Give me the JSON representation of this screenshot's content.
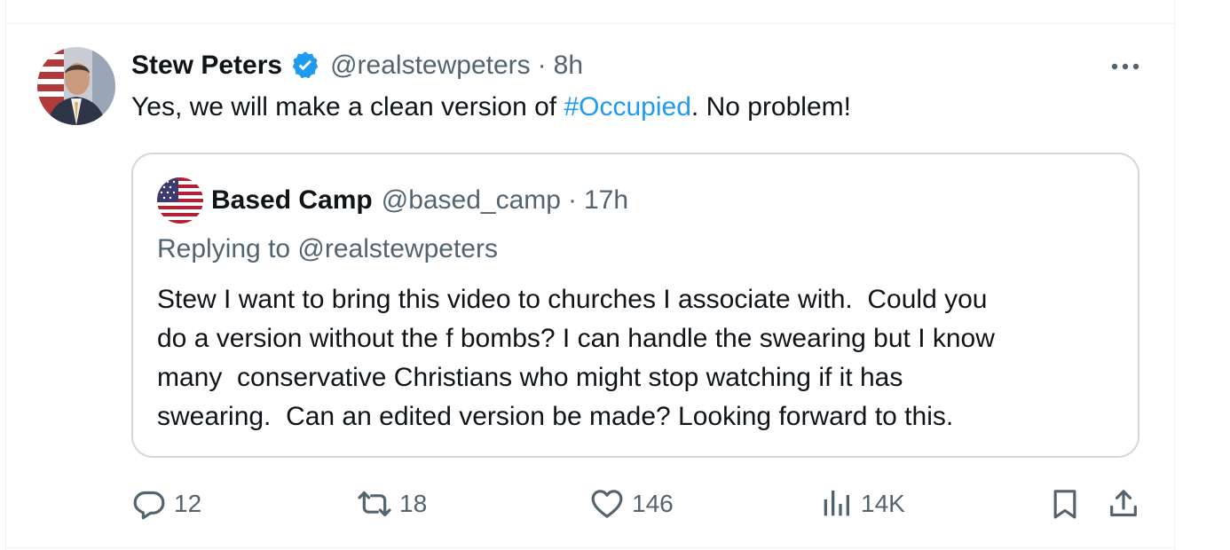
{
  "tweet": {
    "author_name": "Stew Peters",
    "author_handle": "@realstewpeters",
    "separator": "·",
    "time": "8h",
    "text_before": "Yes, we will make a clean version of ",
    "hashtag": "#Occupied",
    "text_after": ". No problem!",
    "more_icon": "more-horizontal-icon"
  },
  "quoted_tweet": {
    "author_name": "Based Camp",
    "author_handle": "@based_camp",
    "separator": "·",
    "time": "17h",
    "replying_to": "Replying to @realstewpeters",
    "text": "Stew I want to bring this video to churches I associate with.  Could you\ndo a version without the f bombs? I can handle the swearing but I know\nmany  conservative Christians who might stop watching if it has\nswearing.  Can an edited version be made? Looking forward to this."
  },
  "actions": {
    "replies": "12",
    "retweets": "18",
    "likes": "146",
    "views": "14K"
  },
  "colors": {
    "accent": "#1d9bf0",
    "text": "#0f1419",
    "secondary": "#536471",
    "border": "#cfd9de"
  }
}
